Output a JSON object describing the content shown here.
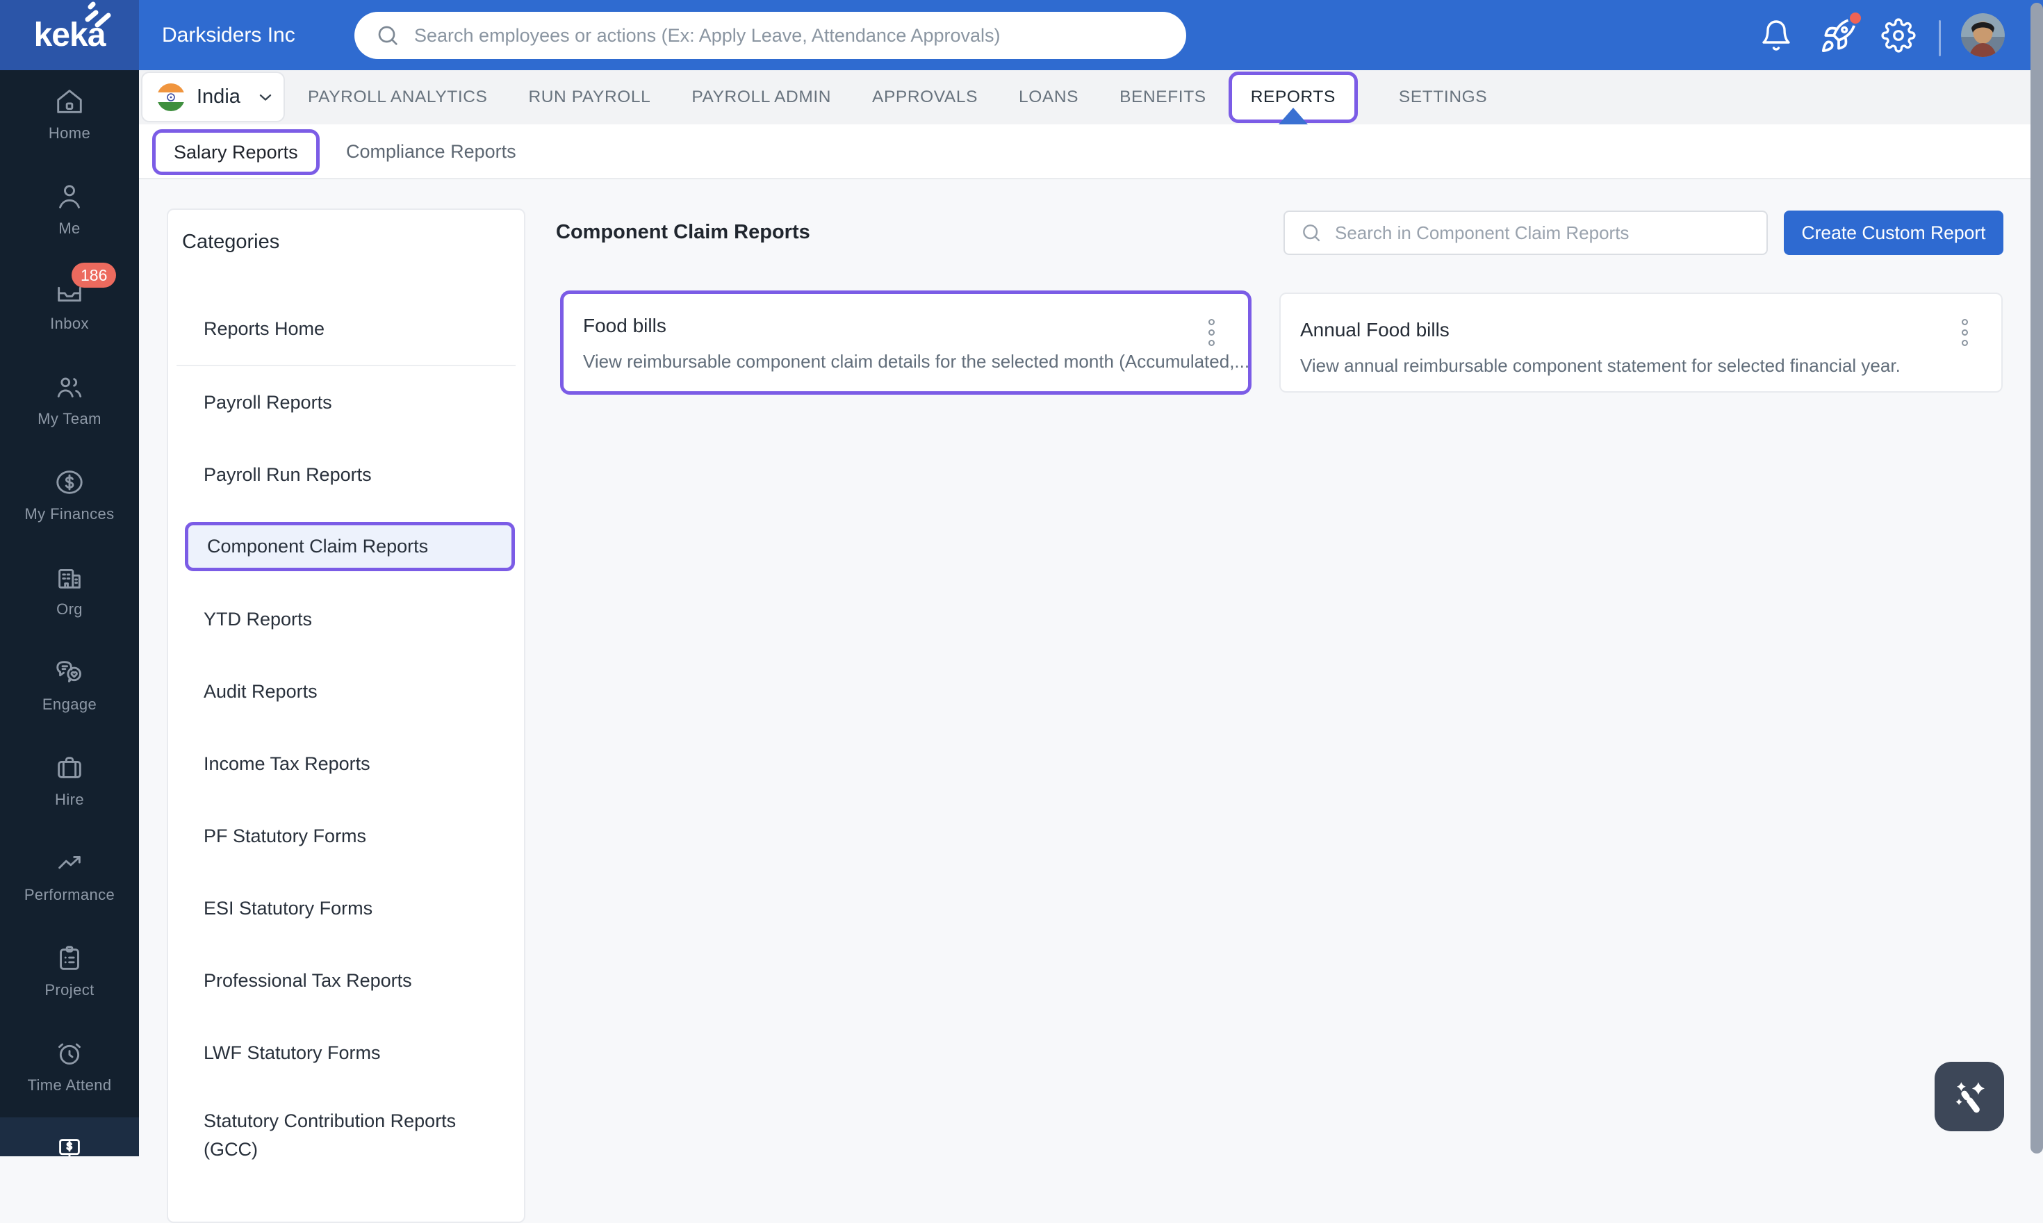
{
  "header": {
    "logo_text": "keka",
    "company_name": "Darksiders Inc",
    "search_placeholder": "Search employees or actions (Ex: Apply Leave, Attendance Approvals)",
    "icons": {
      "search": "search-icon",
      "notifications": "bell-icon",
      "whats_new": "rocket-icon",
      "settings": "gear-icon",
      "profile": "avatar"
    }
  },
  "nav": {
    "country": "India",
    "country_flag": "india-flag-icon",
    "tabs": [
      "PAYROLL ANALYTICS",
      "RUN PAYROLL",
      "PAYROLL ADMIN",
      "APPROVALS",
      "LOANS",
      "BENEFITS",
      "REPORTS",
      "SETTINGS"
    ],
    "active_tab": "REPORTS"
  },
  "subnav": {
    "tabs": [
      "Salary Reports",
      "Compliance Reports"
    ],
    "active_tab": "Salary Reports"
  },
  "sidebar": {
    "items": [
      {
        "label": "Home",
        "icon": "home-icon"
      },
      {
        "label": "Me",
        "icon": "person-icon"
      },
      {
        "label": "Inbox",
        "icon": "inbox-icon",
        "badge": "186"
      },
      {
        "label": "My Team",
        "icon": "team-icon"
      },
      {
        "label": "My Finances",
        "icon": "dollar-circle-icon"
      },
      {
        "label": "Org",
        "icon": "building-icon"
      },
      {
        "label": "Engage",
        "icon": "chat-bubbles-icon"
      },
      {
        "label": "Hire",
        "icon": "briefcase-icon"
      },
      {
        "label": "Performance",
        "icon": "trend-arrow-icon"
      },
      {
        "label": "Project",
        "icon": "clipboard-icon"
      },
      {
        "label": "Time Attend",
        "icon": "alarm-clock-icon"
      }
    ],
    "bottom_active_item": {
      "icon": "payroll-monitor-icon"
    }
  },
  "categories": {
    "title": "Categories",
    "items": [
      "Reports Home",
      "Payroll Reports",
      "Payroll Run Reports",
      "Component Claim Reports",
      "YTD Reports",
      "Audit Reports",
      "Income Tax Reports",
      "PF Statutory Forms",
      "ESI Statutory Forms",
      "Professional Tax Reports",
      "LWF Statutory Forms",
      "Statutory Contribution Reports (GCC)"
    ],
    "active_item": "Component Claim Reports"
  },
  "content": {
    "title": "Component Claim Reports",
    "search_placeholder": "Search in Component Claim Reports",
    "create_button_label": "Create Custom Report",
    "cards": [
      {
        "title": "Food bills",
        "description": "View reimbursable component claim details for the selected month (Accumulated,...",
        "menu_icon": "kebab-menu-icon"
      },
      {
        "title": "Annual Food bills",
        "description": "View annual reimbursable component statement for selected financial year.",
        "menu_icon": "kebab-menu-icon"
      }
    ]
  },
  "fab": {
    "icon": "magic-wand-icon"
  },
  "colors": {
    "header_blue": "#2f6bd0",
    "logo_block_blue": "#2b55a8",
    "sidebar_navy": "#13202e",
    "sidebar_active_bg": "#1c2d43",
    "annotation_purple": "#7b5ce6",
    "badge_salmon": "#ec6a5e",
    "primary_button_blue": "#2e6ad1",
    "page_background": "#f7f8fa",
    "active_category_bg": "#edf2fc",
    "tab_pointer_blue": "#3a70d2"
  }
}
